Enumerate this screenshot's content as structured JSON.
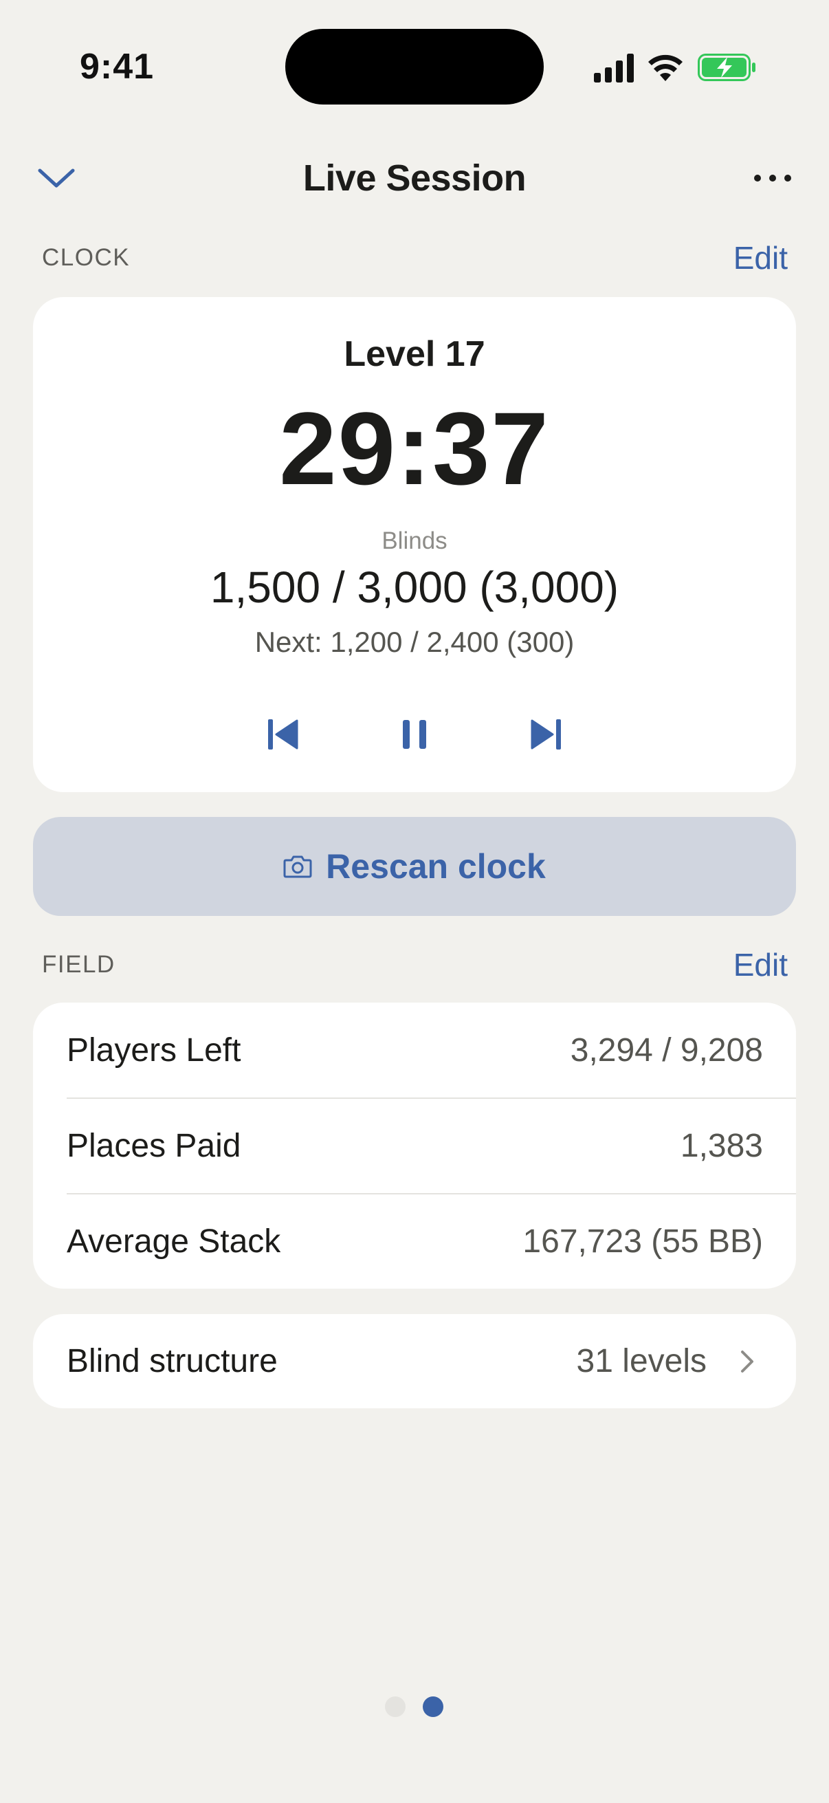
{
  "status_bar": {
    "time": "9:41"
  },
  "nav": {
    "title": "Live Session"
  },
  "clock": {
    "section_label": "CLOCK",
    "edit_label": "Edit",
    "level": "Level 17",
    "time_remaining": "29:37",
    "blinds_label": "Blinds",
    "blinds": "1,500 / 3,000 (3,000)",
    "next": "Next: 1,200 / 2,400 (300)"
  },
  "rescan": {
    "label": "Rescan clock"
  },
  "field": {
    "section_label": "FIELD",
    "edit_label": "Edit",
    "rows": [
      {
        "label": "Players Left",
        "value": "3,294 / 9,208"
      },
      {
        "label": "Places Paid",
        "value": "1,383"
      },
      {
        "label": "Average Stack",
        "value": "167,723 (55 BB)"
      }
    ]
  },
  "blind_structure": {
    "label": "Blind structure",
    "value": "31 levels"
  },
  "pager": {
    "pages": 2,
    "active_page": 2
  },
  "colors": {
    "accent": "#3b63a8",
    "background": "#f2f1ed",
    "card": "#ffffff",
    "battery_green": "#34c759"
  },
  "icons": {
    "nav_back": "chevron-down-icon",
    "nav_more": "more-horizontal-icon",
    "prev": "skip-previous-icon",
    "pause": "pause-icon",
    "next": "skip-next-icon",
    "rescan": "camera-icon",
    "blind_structure": "chevron-right-icon"
  }
}
